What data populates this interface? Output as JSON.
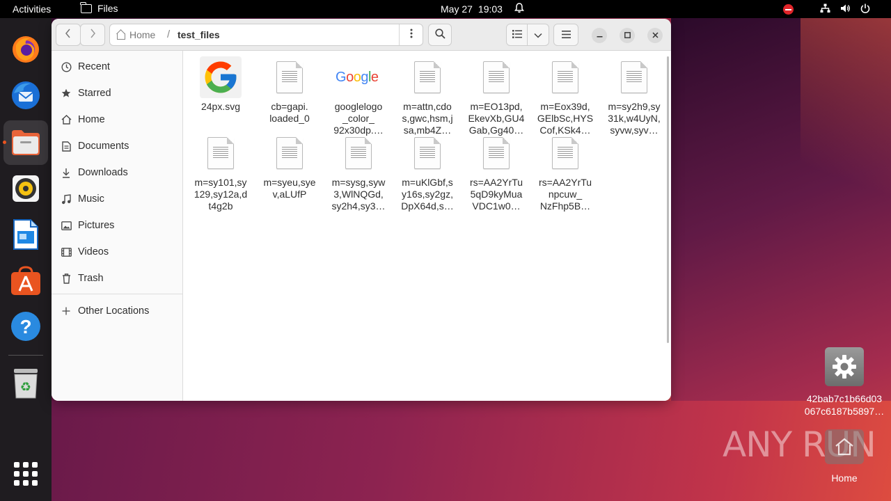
{
  "topbar": {
    "activities": "Activities",
    "app_name": "Files",
    "date": "May 27",
    "time": "19:03"
  },
  "dock": {
    "apps": [
      {
        "name": "firefox",
        "icon": "firefox-icon"
      },
      {
        "name": "thunderbird",
        "icon": "thunderbird-icon"
      },
      {
        "name": "files",
        "icon": "files-icon"
      },
      {
        "name": "rhythmbox",
        "icon": "rhythmbox-icon"
      },
      {
        "name": "writer",
        "icon": "libreoffice-writer-icon"
      },
      {
        "name": "software",
        "icon": "app-center-icon"
      },
      {
        "name": "help",
        "icon": "help-icon"
      },
      {
        "name": "trash",
        "icon": "trash-icon"
      }
    ]
  },
  "window": {
    "path_home": "Home",
    "path_separator": "/",
    "path_current": "test_files"
  },
  "sidebar": {
    "items": [
      {
        "label": "Recent",
        "icon": "clock-icon"
      },
      {
        "label": "Starred",
        "icon": "star-icon"
      },
      {
        "label": "Home",
        "icon": "home-icon"
      },
      {
        "label": "Documents",
        "icon": "document-icon"
      },
      {
        "label": "Downloads",
        "icon": "download-icon"
      },
      {
        "label": "Music",
        "icon": "music-icon"
      },
      {
        "label": "Pictures",
        "icon": "picture-icon"
      },
      {
        "label": "Videos",
        "icon": "video-icon"
      },
      {
        "label": "Trash",
        "icon": "trash-icon"
      }
    ],
    "other_locations": "Other Locations"
  },
  "files": [
    {
      "label": "24px.svg",
      "type": "google-g"
    },
    {
      "label": "cb=gapi.\nloaded_0",
      "type": "doc"
    },
    {
      "label": "googlelogo\n_color_\n92x30dp.…",
      "type": "google-logo"
    },
    {
      "label": "m=attn,cdo\ns,gwc,hsm,j\nsa,mb4Z…",
      "type": "doc"
    },
    {
      "label": "m=EO13pd,\nEkevXb,GU4\nGab,Gg40…",
      "type": "doc"
    },
    {
      "label": "m=Eox39d,\nGElbSc,HYS\nCof,KSk4…",
      "type": "doc"
    },
    {
      "label": "m=sy2h9,sy\n31k,w4UyN,\nsyvw,syv…",
      "type": "doc"
    },
    {
      "label": "m=sy101,sy\n129,sy12a,d\nt4g2b",
      "type": "doc"
    },
    {
      "label": "m=syeu,sye\nv,aLUfP",
      "type": "doc"
    },
    {
      "label": "m=sysg,syw\n3,WlNQGd,\nsy2h4,sy3…",
      "type": "doc"
    },
    {
      "label": "m=uKlGbf,s\ny16s,sy2gz,\nDpX64d,s…",
      "type": "doc"
    },
    {
      "label": "rs=AA2YrTu\n5qD9kyMua\nVDC1w0…",
      "type": "doc"
    },
    {
      "label": "rs=AA2YrTu\nnpcuw_\nNzFhp5B…",
      "type": "doc"
    }
  ],
  "desktop": {
    "file_label": "42bab7c1b66d03\n067c6187b5897…",
    "home_label": "Home",
    "watermark": "ANY RUN"
  },
  "colors": {
    "accent": "#e95420",
    "topbar": "#000000",
    "dock": "#1f1c20"
  }
}
